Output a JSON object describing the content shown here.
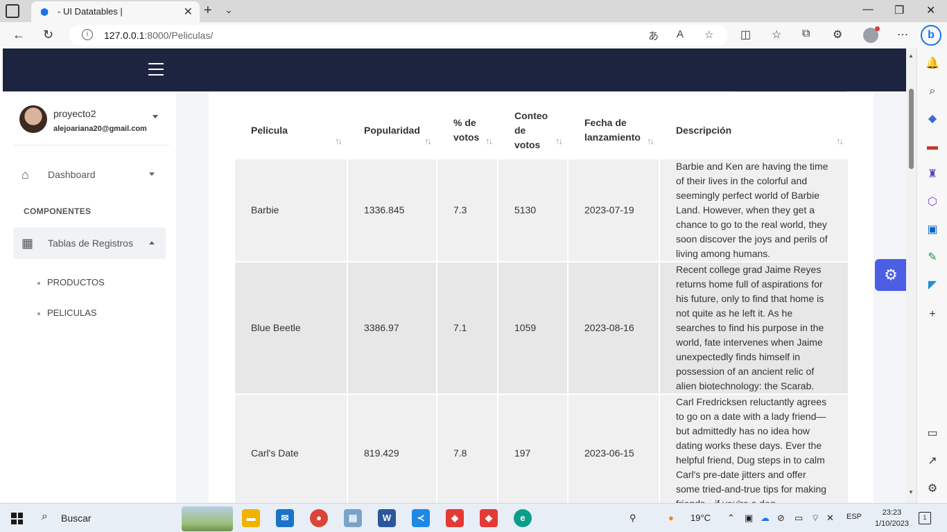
{
  "browser": {
    "tab_title": "- UI Datatables |",
    "url_host": "127.0.0.1",
    "url_path": ":8000/Peliculas/"
  },
  "user": {
    "name": "proyecto2",
    "email": "alejoariana20@gmail.com"
  },
  "sidebar": {
    "dashboard_label": "Dashboard",
    "section_title": "COMPONENTES",
    "tables_label": "Tablas de Registros",
    "sub_items": [
      "PRODUCTOS",
      "PELICULAS"
    ]
  },
  "table": {
    "headers": {
      "pelicula": "Pelicula",
      "popularidad": "Popularidad",
      "votos_pct_1": "% de",
      "votos_pct_2": "votos",
      "conteo_1": "Conteo",
      "conteo_2": "de",
      "conteo_3": "votos",
      "fecha_1": "Fecha de",
      "fecha_2": "lanzamiento",
      "descripcion": "Descripción"
    },
    "rows": [
      {
        "pelicula": "Barbie",
        "popularidad": "1336.845",
        "votos": "7.3",
        "conteo": "5130",
        "fecha": "2023-07-19",
        "descripcion": "Barbie and Ken are having the time of their lives in the colorful and seemingly perfect world of Barbie Land. However, when they get a chance to go to the real world, they soon discover the joys and perils of living among humans."
      },
      {
        "pelicula": "Blue Beetle",
        "popularidad": "3386.97",
        "votos": "7.1",
        "conteo": "1059",
        "fecha": "2023-08-16",
        "descripcion": "Recent college grad Jaime Reyes returns home full of aspirations for his future, only to find that home is not quite as he left it. As he searches to find his purpose in the world, fate intervenes when Jaime unexpectedly finds himself in possession of an ancient relic of alien biotechnology: the Scarab."
      },
      {
        "pelicula": "Carl's Date",
        "popularidad": "819.429",
        "votos": "7.8",
        "conteo": "197",
        "fecha": "2023-06-15",
        "descripcion": "Carl Fredricksen reluctantly agrees to go on a date with a lady friend—but admittedly has no idea how dating works these days. Ever the helpful friend, Dug steps in to calm Carl's pre-date jitters and offer some tried-and-true tips for making friends—if you're a dog."
      }
    ]
  },
  "taskbar": {
    "search_label": "Buscar",
    "weather": "19°C",
    "lang": "ESP",
    "time": "23:23",
    "date": "1/10/2023",
    "notif_count": "1"
  },
  "colors": {
    "topnav": "#1c2440",
    "accent": "#4b5ee4"
  }
}
